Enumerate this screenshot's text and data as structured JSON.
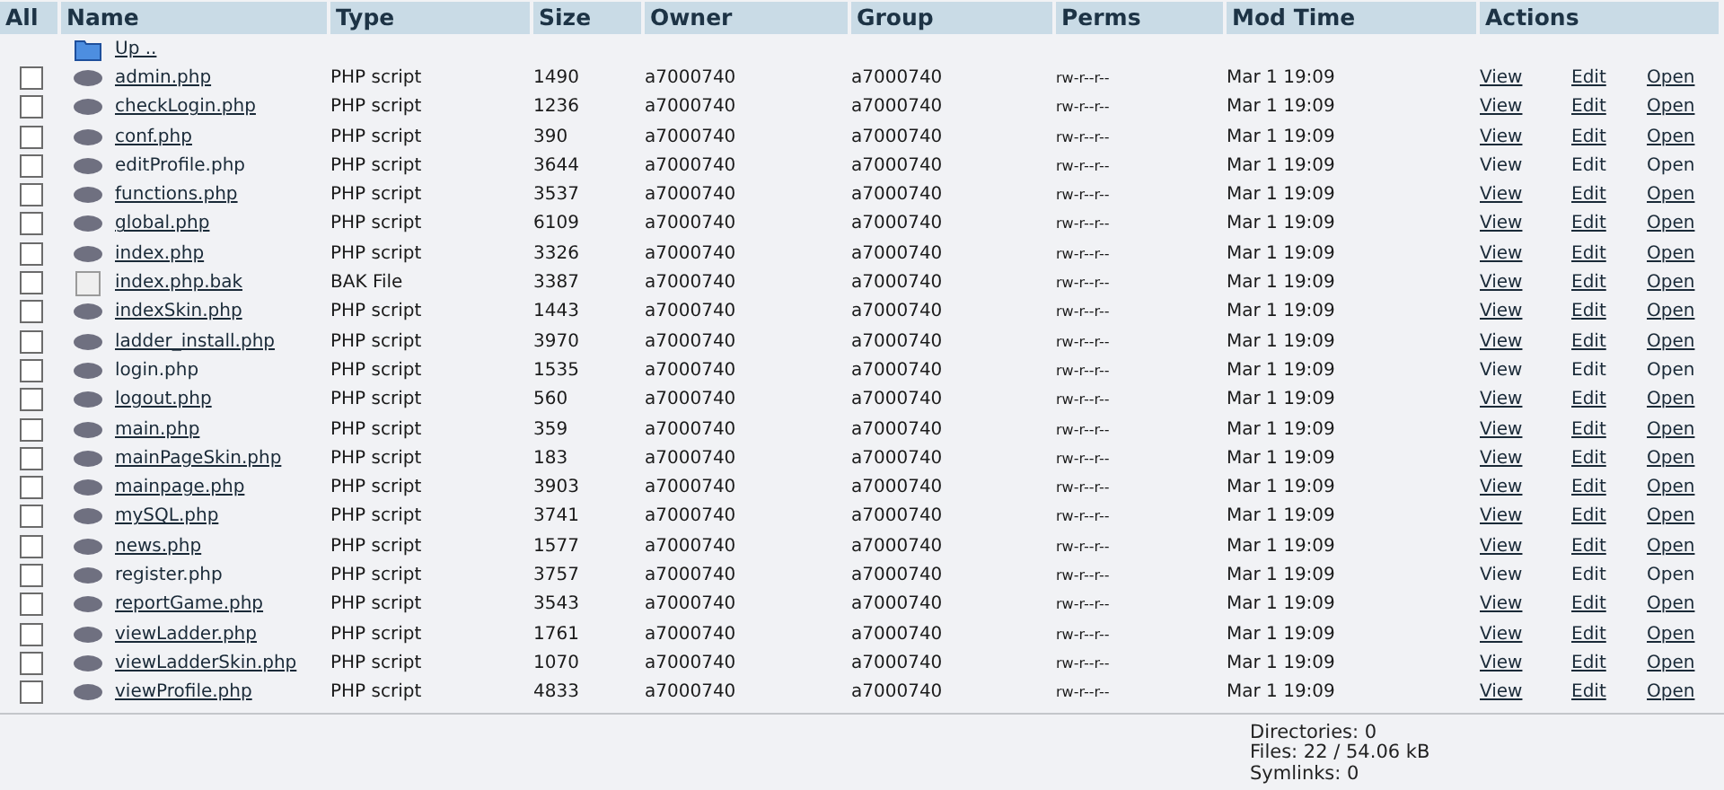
{
  "columns": [
    "All",
    "Name",
    "Type",
    "Size",
    "Owner",
    "Group",
    "Perms",
    "Mod Time",
    "Actions"
  ],
  "up": {
    "kind": "folder",
    "name": "Up .."
  },
  "rows": [
    {
      "kind": "php",
      "name": "admin.php",
      "type": "PHP script",
      "size": "1490",
      "owner": "a7000740",
      "group": "a7000740",
      "perms": "rw-r--r--",
      "time": "Mar 1 19:09",
      "linked": true,
      "checked": false,
      "actions": [
        "View",
        "Edit",
        "Open"
      ]
    },
    {
      "kind": "php",
      "name": "checkLogin.php",
      "type": "PHP script",
      "size": "1236",
      "owner": "a7000740",
      "group": "a7000740",
      "perms": "rw-r--r--",
      "time": "Mar 1 19:09",
      "linked": true,
      "checked": false,
      "actions": [
        "View",
        "Edit",
        "Open"
      ]
    },
    {
      "kind": "php",
      "name": "conf.php",
      "type": "PHP script",
      "size": "390",
      "owner": "a7000740",
      "group": "a7000740",
      "perms": "rw-r--r--",
      "time": "Mar 1 19:09",
      "linked": true,
      "checked": false,
      "actions": [
        "View",
        "Edit",
        "Open"
      ]
    },
    {
      "kind": "php",
      "name": "editProfile.php",
      "type": "PHP script",
      "size": "3644",
      "owner": "a7000740",
      "group": "a7000740",
      "perms": "rw-r--r--",
      "time": "Mar 1 19:09",
      "linked": false,
      "checked": false,
      "actions": [
        "View",
        "Edit",
        "Open"
      ]
    },
    {
      "kind": "php",
      "name": "functions.php",
      "type": "PHP script",
      "size": "3537",
      "owner": "a7000740",
      "group": "a7000740",
      "perms": "rw-r--r--",
      "time": "Mar 1 19:09",
      "linked": true,
      "checked": false,
      "actions": [
        "View",
        "Edit",
        "Open"
      ]
    },
    {
      "kind": "php",
      "name": "global.php",
      "type": "PHP script",
      "size": "6109",
      "owner": "a7000740",
      "group": "a7000740",
      "perms": "rw-r--r--",
      "time": "Mar 1 19:09",
      "linked": true,
      "checked": false,
      "actions": [
        "View",
        "Edit",
        "Open"
      ]
    },
    {
      "kind": "php",
      "name": "index.php",
      "type": "PHP script",
      "size": "3326",
      "owner": "a7000740",
      "group": "a7000740",
      "perms": "rw-r--r--",
      "time": "Mar 1 19:09",
      "linked": true,
      "checked": false,
      "actions": [
        "View",
        "Edit",
        "Open"
      ]
    },
    {
      "kind": "file",
      "name": "index.php.bak",
      "type": "BAK File",
      "size": "3387",
      "owner": "a7000740",
      "group": "a7000740",
      "perms": "rw-r--r--",
      "time": "Mar 1 19:09",
      "linked": true,
      "checked": false,
      "actions": [
        "View",
        "Edit",
        "Open"
      ]
    },
    {
      "kind": "php",
      "name": "indexSkin.php",
      "type": "PHP script",
      "size": "1443",
      "owner": "a7000740",
      "group": "a7000740",
      "perms": "rw-r--r--",
      "time": "Mar 1 19:09",
      "linked": true,
      "checked": false,
      "actions": [
        "View",
        "Edit",
        "Open"
      ]
    },
    {
      "kind": "php",
      "name": "ladder_install.php",
      "type": "PHP script",
      "size": "3970",
      "owner": "a7000740",
      "group": "a7000740",
      "perms": "rw-r--r--",
      "time": "Mar 1 19:09",
      "linked": true,
      "checked": false,
      "actions": [
        "View",
        "Edit",
        "Open"
      ]
    },
    {
      "kind": "php",
      "name": "login.php",
      "type": "PHP script",
      "size": "1535",
      "owner": "a7000740",
      "group": "a7000740",
      "perms": "rw-r--r--",
      "time": "Mar 1 19:09",
      "linked": false,
      "checked": false,
      "actions": [
        "View",
        "Edit",
        "Open"
      ]
    },
    {
      "kind": "php",
      "name": "logout.php",
      "type": "PHP script",
      "size": "560",
      "owner": "a7000740",
      "group": "a7000740",
      "perms": "rw-r--r--",
      "time": "Mar 1 19:09",
      "linked": true,
      "checked": false,
      "actions": [
        "View",
        "Edit",
        "Open"
      ]
    },
    {
      "kind": "php",
      "name": "main.php",
      "type": "PHP script",
      "size": "359",
      "owner": "a7000740",
      "group": "a7000740",
      "perms": "rw-r--r--",
      "time": "Mar 1 19:09",
      "linked": true,
      "checked": false,
      "actions": [
        "View",
        "Edit",
        "Open"
      ]
    },
    {
      "kind": "php",
      "name": "mainPageSkin.php",
      "type": "PHP script",
      "size": "183",
      "owner": "a7000740",
      "group": "a7000740",
      "perms": "rw-r--r--",
      "time": "Mar 1 19:09",
      "linked": true,
      "checked": false,
      "actions": [
        "View",
        "Edit",
        "Open"
      ]
    },
    {
      "kind": "php",
      "name": "mainpage.php",
      "type": "PHP script",
      "size": "3903",
      "owner": "a7000740",
      "group": "a7000740",
      "perms": "rw-r--r--",
      "time": "Mar 1 19:09",
      "linked": true,
      "checked": false,
      "actions": [
        "View",
        "Edit",
        "Open"
      ]
    },
    {
      "kind": "php",
      "name": "mySQL.php",
      "type": "PHP script",
      "size": "3741",
      "owner": "a7000740",
      "group": "a7000740",
      "perms": "rw-r--r--",
      "time": "Mar 1 19:09",
      "linked": true,
      "checked": false,
      "actions": [
        "View",
        "Edit",
        "Open"
      ]
    },
    {
      "kind": "php",
      "name": "news.php",
      "type": "PHP script",
      "size": "1577",
      "owner": "a7000740",
      "group": "a7000740",
      "perms": "rw-r--r--",
      "time": "Mar 1 19:09",
      "linked": true,
      "checked": false,
      "actions": [
        "View",
        "Edit",
        "Open"
      ]
    },
    {
      "kind": "php",
      "name": "register.php",
      "type": "PHP script",
      "size": "3757",
      "owner": "a7000740",
      "group": "a7000740",
      "perms": "rw-r--r--",
      "time": "Mar 1 19:09",
      "linked": false,
      "checked": false,
      "actions": [
        "View",
        "Edit",
        "Open"
      ]
    },
    {
      "kind": "php",
      "name": "reportGame.php",
      "type": "PHP script",
      "size": "3543",
      "owner": "a7000740",
      "group": "a7000740",
      "perms": "rw-r--r--",
      "time": "Mar 1 19:09",
      "linked": true,
      "checked": false,
      "actions": [
        "View",
        "Edit",
        "Open"
      ]
    },
    {
      "kind": "php",
      "name": "viewLadder.php",
      "type": "PHP script",
      "size": "1761",
      "owner": "a7000740",
      "group": "a7000740",
      "perms": "rw-r--r--",
      "time": "Mar 1 19:09",
      "linked": true,
      "checked": false,
      "actions": [
        "View",
        "Edit",
        "Open"
      ]
    },
    {
      "kind": "php",
      "name": "viewLadderSkin.php",
      "type": "PHP script",
      "size": "1070",
      "owner": "a7000740",
      "group": "a7000740",
      "perms": "rw-r--r--",
      "time": "Mar 1 19:09",
      "linked": true,
      "checked": false,
      "actions": [
        "View",
        "Edit",
        "Open"
      ]
    },
    {
      "kind": "php",
      "name": "viewProfile.php",
      "type": "PHP script",
      "size": "4833",
      "owner": "a7000740",
      "group": "a7000740",
      "perms": "rw-r--r--",
      "time": "Mar 1 19:09",
      "linked": true,
      "checked": false,
      "actions": [
        "View",
        "Edit",
        "Open"
      ]
    }
  ],
  "summary": [
    "Directories: 0",
    "Files: 22 / 54.06 kB",
    "Symlinks: 0"
  ]
}
